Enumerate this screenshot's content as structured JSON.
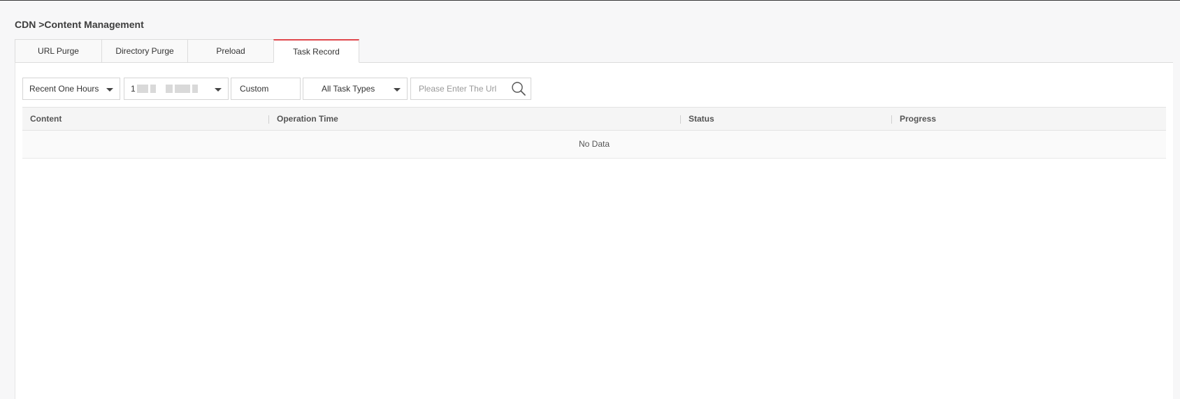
{
  "breadcrumb": "CDN >Content Management",
  "tabs": [
    {
      "label": "URL Purge"
    },
    {
      "label": "Directory Purge"
    },
    {
      "label": "Preload"
    },
    {
      "label": "Task Record"
    }
  ],
  "filters": {
    "time_range": "Recent One Hours",
    "domain_prefix": "1",
    "custom_label": "Custom",
    "task_type": "All Task Types",
    "search_placeholder": "Please Enter The Url"
  },
  "table": {
    "columns": [
      "Content",
      "Operation Time",
      "Status",
      "Progress"
    ],
    "empty_text": "No Data"
  },
  "colors": {
    "active_tab_accent": "#e0474d",
    "page_background": "#f7f7f8",
    "panel_background": "#ffffff"
  }
}
